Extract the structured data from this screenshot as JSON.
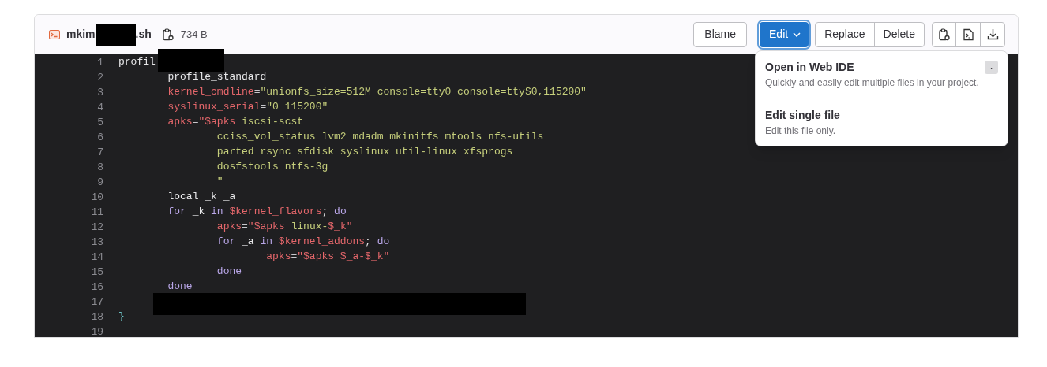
{
  "file_header": {
    "name_start": "mkim",
    "name_end": ".sh",
    "size": "734 B"
  },
  "blame_button": "Blame",
  "edit_button": {
    "label": "Edit",
    "expanded": true
  },
  "replace_button": "Replace",
  "delete_button": "Delete",
  "edit_menu": [
    {
      "title": "Open in Web IDE",
      "description": "Quickly and easily edit multiple files in your project.",
      "shortcut": "."
    },
    {
      "title": "Edit single file",
      "description": "Edit this file only."
    }
  ],
  "code_lines": [
    {
      "number": "1",
      "tokens": [
        {
          "kind": "plain",
          "text": "profil"
        }
      ]
    },
    {
      "number": "2",
      "tokens": [
        {
          "kind": "plain",
          "text": "\tprofile_standard"
        }
      ]
    },
    {
      "number": "3",
      "tokens": [
        {
          "kind": "variable",
          "text": "\tkernel_cmdline"
        },
        {
          "kind": "operator",
          "text": "="
        },
        {
          "kind": "string",
          "text": "\"unionfs_size=512M console=tty0 console=ttyS0,115200\""
        }
      ]
    },
    {
      "number": "4",
      "tokens": [
        {
          "kind": "variable",
          "text": "\tsyslinux_serial"
        },
        {
          "kind": "operator",
          "text": "="
        },
        {
          "kind": "string",
          "text": "\"0 115200\""
        }
      ]
    },
    {
      "number": "5",
      "tokens": [
        {
          "kind": "variable",
          "text": "\tapks"
        },
        {
          "kind": "operator",
          "text": "="
        },
        {
          "kind": "variable",
          "text": "\"$apks"
        },
        {
          "kind": "string",
          "text": " iscsi-scst"
        }
      ]
    },
    {
      "number": "6",
      "tokens": [
        {
          "kind": "string",
          "text": "\t\tcciss_vol_status lvm2 mdadm mkinitfs mtools nfs-utils"
        }
      ]
    },
    {
      "number": "7",
      "tokens": [
        {
          "kind": "string",
          "text": "\t\tparted rsync sfdisk syslinux util-linux xfsprogs"
        }
      ]
    },
    {
      "number": "8",
      "tokens": [
        {
          "kind": "string",
          "text": "\t\tdosfstools ntfs-3g"
        }
      ]
    },
    {
      "number": "9",
      "tokens": [
        {
          "kind": "string",
          "text": "\t\t\""
        }
      ]
    },
    {
      "number": "10",
      "tokens": [
        {
          "kind": "plain",
          "text": "\tlocal _k _a"
        }
      ]
    },
    {
      "number": "11",
      "tokens": [
        {
          "kind": "keyword",
          "text": "\tfor"
        },
        {
          "kind": "plain",
          "text": " _k "
        },
        {
          "kind": "keyword",
          "text": "in "
        },
        {
          "kind": "variable",
          "text": "$kernel_flavors"
        },
        {
          "kind": "plain",
          "text": "; "
        },
        {
          "kind": "keyword",
          "text": "do"
        }
      ]
    },
    {
      "number": "12",
      "tokens": [
        {
          "kind": "variable",
          "text": "\t\tapks"
        },
        {
          "kind": "operator",
          "text": "="
        },
        {
          "kind": "variable",
          "text": "\"$apks"
        },
        {
          "kind": "string",
          "text": " linux-"
        },
        {
          "kind": "variable",
          "text": "$_k"
        },
        {
          "kind": "variable",
          "text": "\""
        }
      ]
    },
    {
      "number": "13",
      "tokens": [
        {
          "kind": "keyword",
          "text": "\t\tfor"
        },
        {
          "kind": "plain",
          "text": " _a "
        },
        {
          "kind": "keyword",
          "text": "in "
        },
        {
          "kind": "variable",
          "text": "$kernel_addons"
        },
        {
          "kind": "plain",
          "text": "; "
        },
        {
          "kind": "keyword",
          "text": "do"
        }
      ]
    },
    {
      "number": "14",
      "tokens": [
        {
          "kind": "variable",
          "text": "\t\t\tapks"
        },
        {
          "kind": "operator",
          "text": "="
        },
        {
          "kind": "variable",
          "text": "\"$apks $_a-$_k\""
        }
      ]
    },
    {
      "number": "15",
      "tokens": [
        {
          "kind": "keyword",
          "text": "\t\tdone"
        }
      ]
    },
    {
      "number": "16",
      "tokens": [
        {
          "kind": "keyword",
          "text": "\tdone"
        }
      ]
    },
    {
      "number": "17"
    },
    {
      "number": "18",
      "tokens": [
        {
          "kind": "brace",
          "text": "}"
        }
      ]
    },
    {
      "number": "19"
    }
  ]
}
